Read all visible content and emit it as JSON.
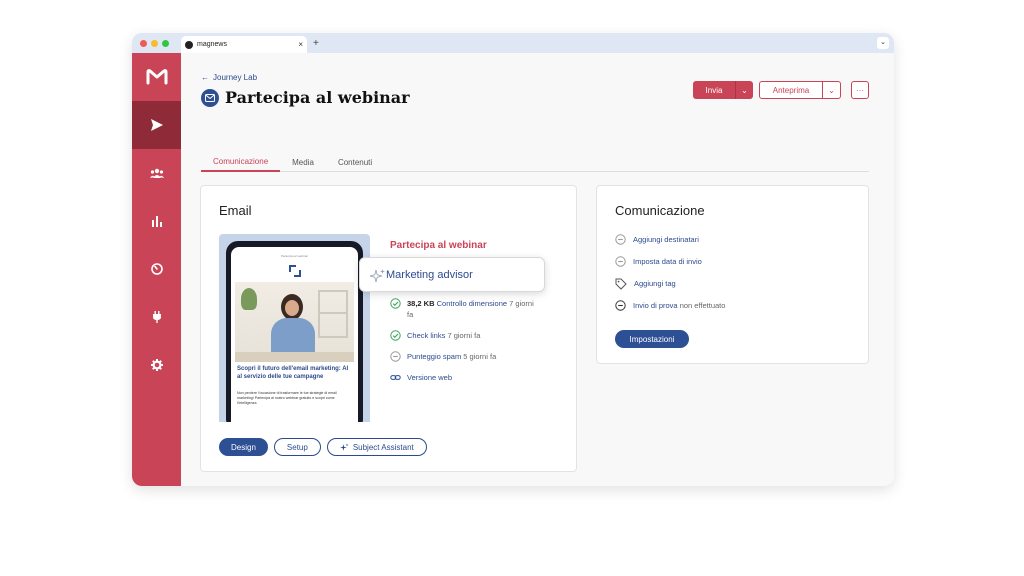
{
  "browser": {
    "tab_title": "magnews",
    "tab_close": "×",
    "new_tab": "+",
    "menu": "⌄"
  },
  "sidebar": {
    "logo": "magnews-logo-icon",
    "items": [
      {
        "icon": "send-icon",
        "active": true
      },
      {
        "icon": "audience-icon",
        "active": false
      },
      {
        "icon": "analytics-icon",
        "active": false
      },
      {
        "icon": "dashboard-icon",
        "active": false
      },
      {
        "icon": "plug-icon",
        "active": false
      },
      {
        "icon": "gear-icon",
        "active": false
      }
    ]
  },
  "header": {
    "breadcrumb_arrow": "←",
    "breadcrumb": "Journey Lab",
    "title": "Partecipa al webinar",
    "actions": {
      "send_label": "Invia",
      "preview_label": "Anteprima",
      "caret": "⌄",
      "more": "···"
    }
  },
  "tabs": [
    {
      "label": "Comunicazione",
      "active": true
    },
    {
      "label": "Media",
      "active": false
    },
    {
      "label": "Contenuti",
      "active": false
    }
  ],
  "email_card": {
    "title": "Email",
    "headline": "Partecipa al webinar",
    "advisor_label": "Marketing advisor",
    "preview": {
      "header_text": "Partecipa al webinar",
      "title": "Scopri il futuro dell'email marketing: AI al servizio delle tue campagne",
      "body": "Non perdere l'occasione di trasformare le tue strategie di email marketing! Partecipa al nostro webinar gratuito e scopri come l'intelligenza"
    },
    "checks": {
      "size_value": "38,2 KB",
      "size_label": "Controllo dimensione",
      "size_time": "7 giorni fa",
      "links_label": "Check links",
      "links_time": "7 giorni fa",
      "spam_label": "Punteggio spam",
      "spam_time": "5 giorni fa",
      "web_label": "Versione web"
    },
    "buttons": {
      "design": "Design",
      "setup": "Setup",
      "subject": "Subject Assistant"
    }
  },
  "communication_card": {
    "title": "Comunicazione",
    "items": {
      "recipients": "Aggiungi destinatari",
      "send_date": "Imposta data di invio",
      "tag": "Aggiungi tag",
      "test_label": "Invio di prova",
      "test_status": "non effettuato"
    },
    "settings_button": "Impostazioni"
  },
  "colors": {
    "brand_red": "#c94456",
    "brand_dark_red": "#8f2a38",
    "brand_blue": "#2d4f93",
    "success_green": "#3aa655"
  }
}
